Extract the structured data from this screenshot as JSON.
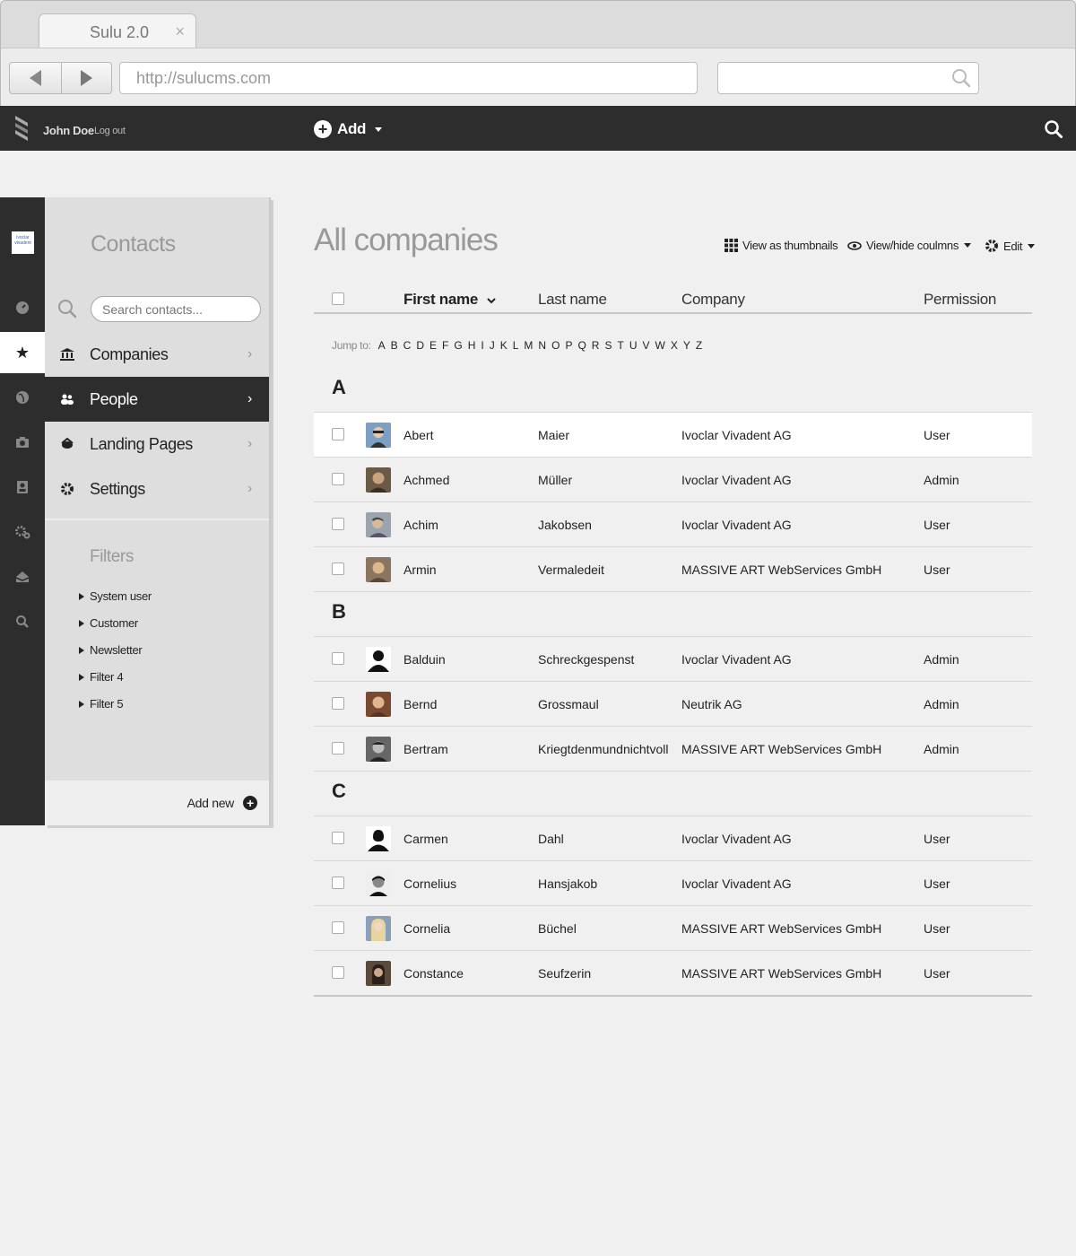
{
  "browser": {
    "tab_title": "Sulu 2.0",
    "tab_close": "×",
    "url": "http://sulucms.com"
  },
  "header": {
    "user_name": "John Doe",
    "logout_label": "Log out",
    "add_label": "Add"
  },
  "sidebar": {
    "brand_text": "ivoclar vivadent",
    "title": "Contacts",
    "search_placeholder": "Search contacts...",
    "nav": [
      {
        "label": "Companies",
        "icon": "bank-icon"
      },
      {
        "label": "People",
        "icon": "people-icon",
        "active": true
      },
      {
        "label": "Landing Pages",
        "icon": "landing-icon"
      },
      {
        "label": "Settings",
        "icon": "gear-icon"
      }
    ],
    "filters_title": "Filters",
    "filters": [
      "System user",
      "Customer",
      "Newsletter",
      "Filter 4",
      "Filter 5"
    ],
    "add_new_label": "Add new"
  },
  "rail_icons": [
    "brand-logo",
    "dashboard-icon",
    "star-icon",
    "globe-icon",
    "camera-icon",
    "contacts-icon",
    "settings-icon",
    "inbox-icon",
    "search-icon"
  ],
  "main": {
    "title": "All companies",
    "tools": {
      "thumbnails_label": "View as thumbnails",
      "columns_label": "View/hide coulmns",
      "edit_label": "Edit"
    },
    "columns": {
      "first_name": "First name",
      "last_name": "Last name",
      "company": "Company",
      "permission": "Permission"
    },
    "jump_label": "Jump to:",
    "letters": [
      "A",
      "B",
      "C",
      "D",
      "E",
      "F",
      "G",
      "H",
      "I",
      "J",
      "K",
      "L",
      "M",
      "N",
      "O",
      "P",
      "Q",
      "R",
      "S",
      "T",
      "U",
      "V",
      "W",
      "X",
      "Y",
      "Z"
    ],
    "groups": [
      {
        "letter": "A",
        "rows": [
          {
            "first": "Abert",
            "last": "Maier",
            "company": "Ivoclar Vivadent AG",
            "permission": "User"
          },
          {
            "first": "Achmed",
            "last": "Müller",
            "company": "Ivoclar Vivadent AG",
            "permission": "Admin"
          },
          {
            "first": "Achim",
            "last": "Jakobsen",
            "company": "Ivoclar Vivadent AG",
            "permission": "User"
          },
          {
            "first": "Armin",
            "last": "Vermaledeit",
            "company": "MASSIVE ART WebServices GmbH",
            "permission": "User"
          }
        ]
      },
      {
        "letter": "B",
        "rows": [
          {
            "first": "Balduin",
            "last": "Schreckgespenst",
            "company": "Ivoclar Vivadent AG",
            "permission": "Admin"
          },
          {
            "first": "Bernd",
            "last": "Grossmaul",
            "company": "Neutrik AG",
            "permission": "Admin"
          },
          {
            "first": "Bertram",
            "last": "Kriegtdenmundnichtvoll",
            "company": "MASSIVE ART WebServices GmbH",
            "permission": "Admin"
          }
        ]
      },
      {
        "letter": "C",
        "rows": [
          {
            "first": "Carmen",
            "last": "Dahl",
            "company": "Ivoclar Vivadent AG",
            "permission": "User"
          },
          {
            "first": "Cornelius",
            "last": "Hansjakob",
            "company": "Ivoclar Vivadent AG",
            "permission": "User"
          },
          {
            "first": "Cornelia",
            "last": "Büchel",
            "company": "MASSIVE ART WebServices GmbH",
            "permission": "User"
          },
          {
            "first": "Constance",
            "last": "Seufzerin",
            "company": "MASSIVE ART WebServices GmbH",
            "permission": "User"
          }
        ]
      }
    ]
  },
  "colors": {
    "dark": "#2d2d2d",
    "sidebar_bg": "#dedede",
    "page_bg": "#f0f0f0",
    "muted_text": "#999999"
  }
}
